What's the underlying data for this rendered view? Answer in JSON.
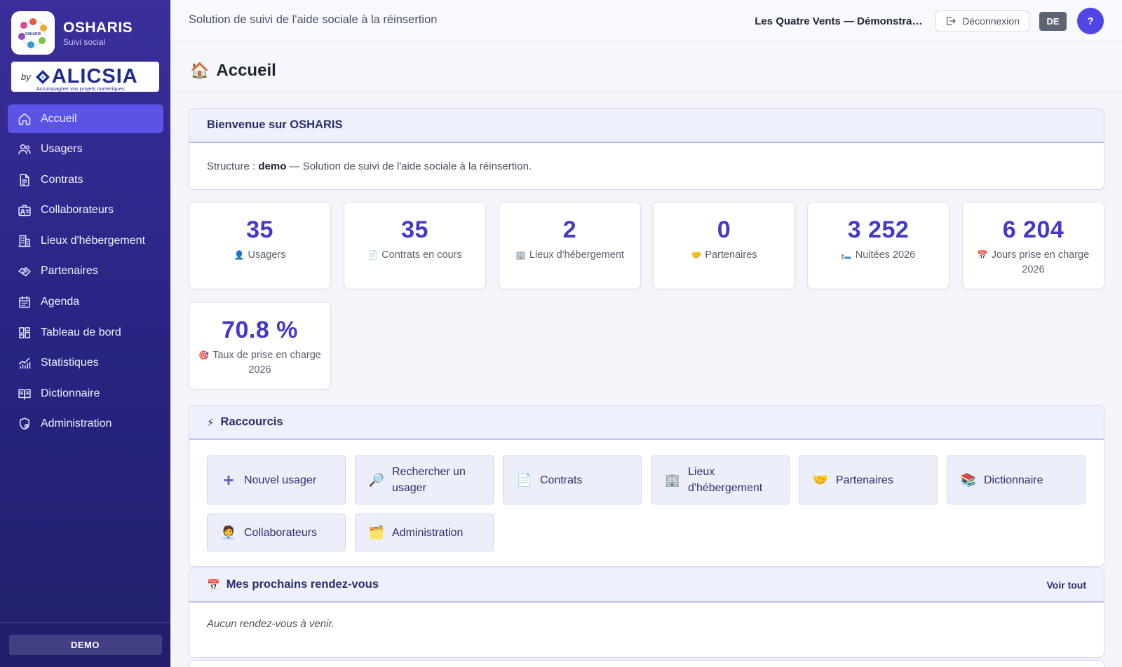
{
  "sidebar": {
    "brand_name": "OSHARIS",
    "brand_sub": "Suivi social",
    "by_label": "by",
    "partner_logo": "ALICSIA",
    "partner_tagline": "Accompagner vos projets numériques",
    "items": [
      {
        "label": "Accueil",
        "icon": "home-icon"
      },
      {
        "label": "Usagers",
        "icon": "users-icon"
      },
      {
        "label": "Contrats",
        "icon": "document-icon"
      },
      {
        "label": "Collaborateurs",
        "icon": "id-card-icon"
      },
      {
        "label": "Lieux d'hébergement",
        "icon": "building-icon"
      },
      {
        "label": "Partenaires",
        "icon": "handshake-icon"
      },
      {
        "label": "Agenda",
        "icon": "calendar-icon"
      },
      {
        "label": "Tableau de bord",
        "icon": "dashboard-icon"
      },
      {
        "label": "Statistiques",
        "icon": "chart-icon"
      },
      {
        "label": "Dictionnaire",
        "icon": "book-icon"
      },
      {
        "label": "Administration",
        "icon": "admin-shield-icon"
      }
    ],
    "footer_badge": "DEMO"
  },
  "topbar": {
    "title": "Solution de suivi de l'aide sociale à la réinsertion",
    "org_name": "Les Quatre Vents — Démonstration",
    "logout_label": "Déconnexion",
    "lang": "DE",
    "help": "?"
  },
  "page": {
    "title": "Accueil",
    "title_emoji": "🏠"
  },
  "welcome": {
    "title": "Bienvenue sur OSHARIS",
    "structure_prefix": "Structure : ",
    "structure_name": "demo",
    "structure_suffix": " — Solution de suivi de l'aide sociale à la réinsertion."
  },
  "stats": [
    {
      "value": "35",
      "icon": "👤",
      "label": "Usagers"
    },
    {
      "value": "35",
      "icon": "📄",
      "label": "Contrats en cours"
    },
    {
      "value": "2",
      "icon": "🏢",
      "label": "Lieux d'hébergement"
    },
    {
      "value": "0",
      "icon": "🤝",
      "label": "Partenaires"
    },
    {
      "value": "3 252",
      "icon": "🛏️",
      "label": "Nuitées 2026"
    },
    {
      "value": "6 204",
      "icon": "📅",
      "label": "Jours prise en charge 2026"
    },
    {
      "value": "70.8 %",
      "icon": "🎯",
      "label": "Taux de prise en charge 2026"
    }
  ],
  "shortcuts": {
    "title": "Raccourcis",
    "icon": "⚡",
    "items": [
      {
        "icon": "+",
        "label": "Nouvel usager"
      },
      {
        "icon": "🔎",
        "label": "Rechercher un usager"
      },
      {
        "icon": "📄",
        "label": "Contrats"
      },
      {
        "icon": "🏢",
        "label": "Lieux d'hébergement"
      },
      {
        "icon": "🤝",
        "label": "Partenaires"
      },
      {
        "icon": "📚",
        "label": "Dictionnaire"
      },
      {
        "icon": "🧑‍💼",
        "label": "Collaborateurs"
      },
      {
        "icon": "🗂️",
        "label": "Administration"
      }
    ]
  },
  "appointments": {
    "title": "Mes prochains rendez-vous",
    "icon": "📅",
    "see_all": "Voir tout",
    "empty": "Aucun rendez-vous à venir."
  },
  "colors": {
    "accent": "#4f46e5",
    "sidebar_top": "#3a2f9a",
    "sidebar_bottom": "#211f6b",
    "stat_value": "#4338ca"
  }
}
